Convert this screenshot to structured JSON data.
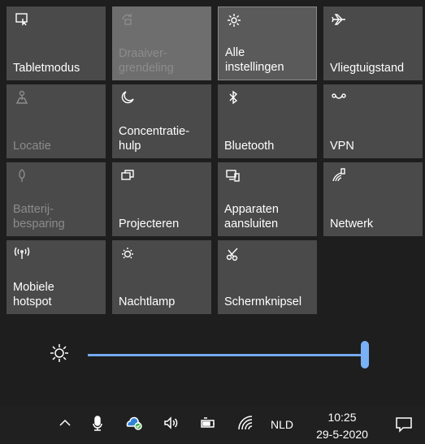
{
  "tiles": [
    {
      "label": "Tabletmodus",
      "icon": "tablet-mode-icon",
      "state": "normal"
    },
    {
      "label": "Draaivergrendeling",
      "label_lines": [
        "Draaiver-",
        "grendeling"
      ],
      "icon": "rotation-lock-icon",
      "state": "dim-highlight"
    },
    {
      "label": "Alle instellingen",
      "label_lines": [
        "Alle",
        "instellingen"
      ],
      "icon": "gear-icon",
      "state": "active"
    },
    {
      "label": "Vliegtuigstand",
      "icon": "airplane-icon",
      "state": "normal"
    },
    {
      "label": "Locatie",
      "icon": "location-icon",
      "state": "dim"
    },
    {
      "label": "Concentratiehulp",
      "label_lines": [
        "Concentratie-",
        "hulp"
      ],
      "icon": "moon-icon",
      "state": "normal"
    },
    {
      "label": "Bluetooth",
      "icon": "bluetooth-icon",
      "state": "normal"
    },
    {
      "label": "VPN",
      "icon": "vpn-icon",
      "state": "normal"
    },
    {
      "label": "Batterijbesparing",
      "label_lines": [
        "Batterij-",
        "besparing"
      ],
      "icon": "battery-saver-icon",
      "state": "dim"
    },
    {
      "label": "Projecteren",
      "icon": "project-icon",
      "state": "normal"
    },
    {
      "label": "Apparaten aansluiten",
      "label_lines": [
        "Apparaten",
        "aansluiten"
      ],
      "icon": "connect-icon",
      "state": "normal"
    },
    {
      "label": "Netwerk",
      "icon": "network-icon",
      "state": "normal"
    },
    {
      "label": "Mobiele hotspot",
      "label_lines": [
        "Mobiele",
        "hotspot"
      ],
      "icon": "hotspot-icon",
      "state": "normal"
    },
    {
      "label": "Nachtlamp",
      "icon": "night-light-icon",
      "state": "normal"
    },
    {
      "label": "Schermknipsel",
      "icon": "snip-icon",
      "state": "normal"
    }
  ],
  "brightness": {
    "icon": "sun-icon",
    "level": 1.0,
    "accent": "#74aaf0"
  },
  "taskbar": {
    "language": "NLD",
    "time": "10:25",
    "date": "29-5-2020",
    "icons": [
      "chevron-up-icon",
      "microphone-icon",
      "onedrive-icon",
      "volume-icon",
      "battery-icon",
      "wifi-icon",
      "notification-icon"
    ]
  },
  "colors": {
    "tile": "#4a4a4a",
    "tile_active": "#5a5a5a",
    "tile_dim_text": "#8c8c8c",
    "background": "#1e1e1e"
  }
}
